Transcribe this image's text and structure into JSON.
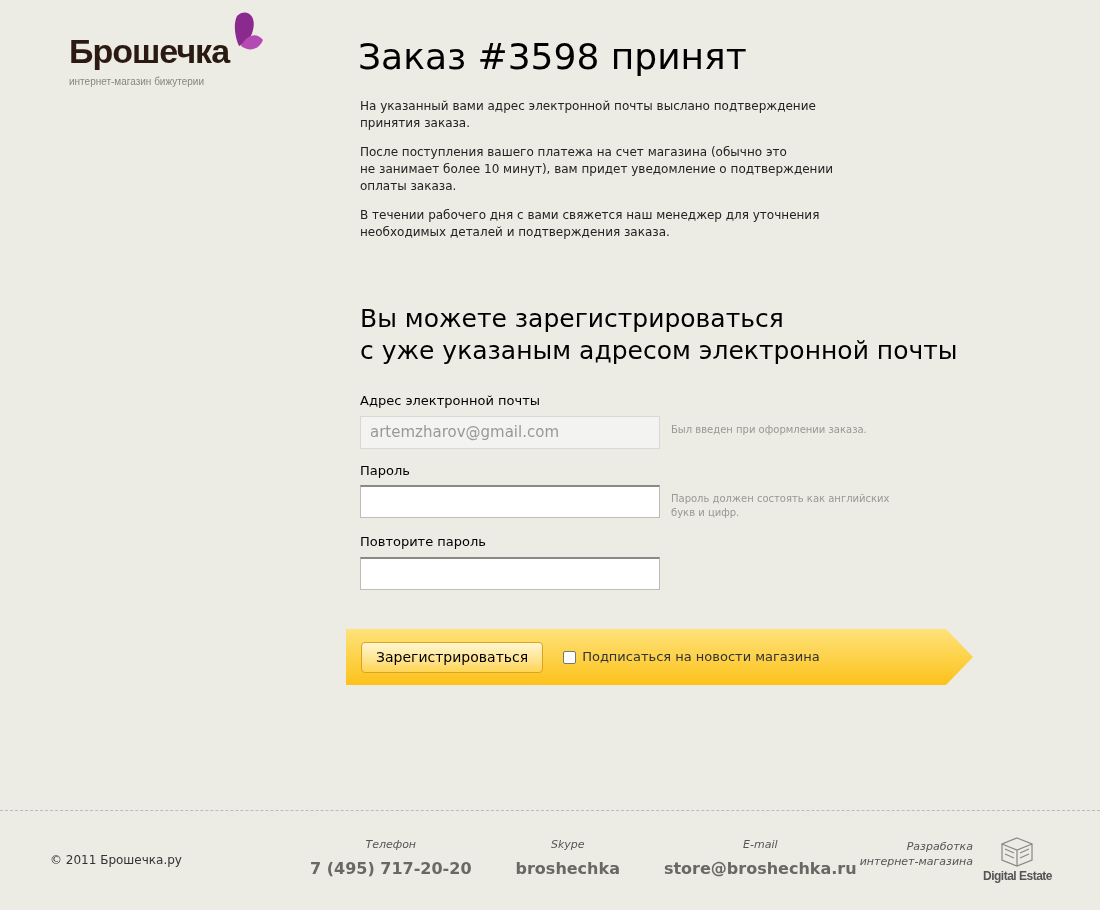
{
  "logo": {
    "name": "Брошечка",
    "tagline": "интернет-магазин бижутерии"
  },
  "title": "Заказ #3598 принят",
  "paragraphs": [
    "На указанный вами адрес электронной почты выслано подтверждение\nпринятия заказа.",
    "После поступления вашего платежа на счет магазина (обычно это\nне занимает более 10 минут), вам придет уведомление о подтверждении\nоплаты заказа.",
    "В течении рабочего дня с вами свяжется наш менеджер для уточнения\nнеобходимых деталей и подтверждения заказа."
  ],
  "register_heading": "Вы можете зарегистрироваться\nс уже указаным адресом электронной почты",
  "fields": [
    {
      "label": "Адрес электронной почты",
      "value": "artemzharov@gmail.com",
      "disabled": true,
      "hint": "Был введен при оформлении заказа."
    },
    {
      "label": "Пароль",
      "disabled": false,
      "hint": "Пароль должен состоять как английских\nбукв и цифр."
    },
    {
      "label": "Повторите пароль",
      "disabled": false
    }
  ],
  "register_button": "Зарегистрироваться",
  "subscribe": {
    "label": "Подписаться на новости магазина",
    "checked": false
  },
  "footer": {
    "copyright": "© 2011 Брошечка.ру",
    "contacts": [
      {
        "label": "Телефон",
        "value": "7 (495) 717-20-20"
      },
      {
        "label": "Skype",
        "value": "broshechka"
      },
      {
        "label": "E-mail",
        "value": "store@broshechka.ru"
      }
    ],
    "developer_caption": "Разработка\nинтернет-магазина",
    "developer_name": "Digital Estate"
  }
}
